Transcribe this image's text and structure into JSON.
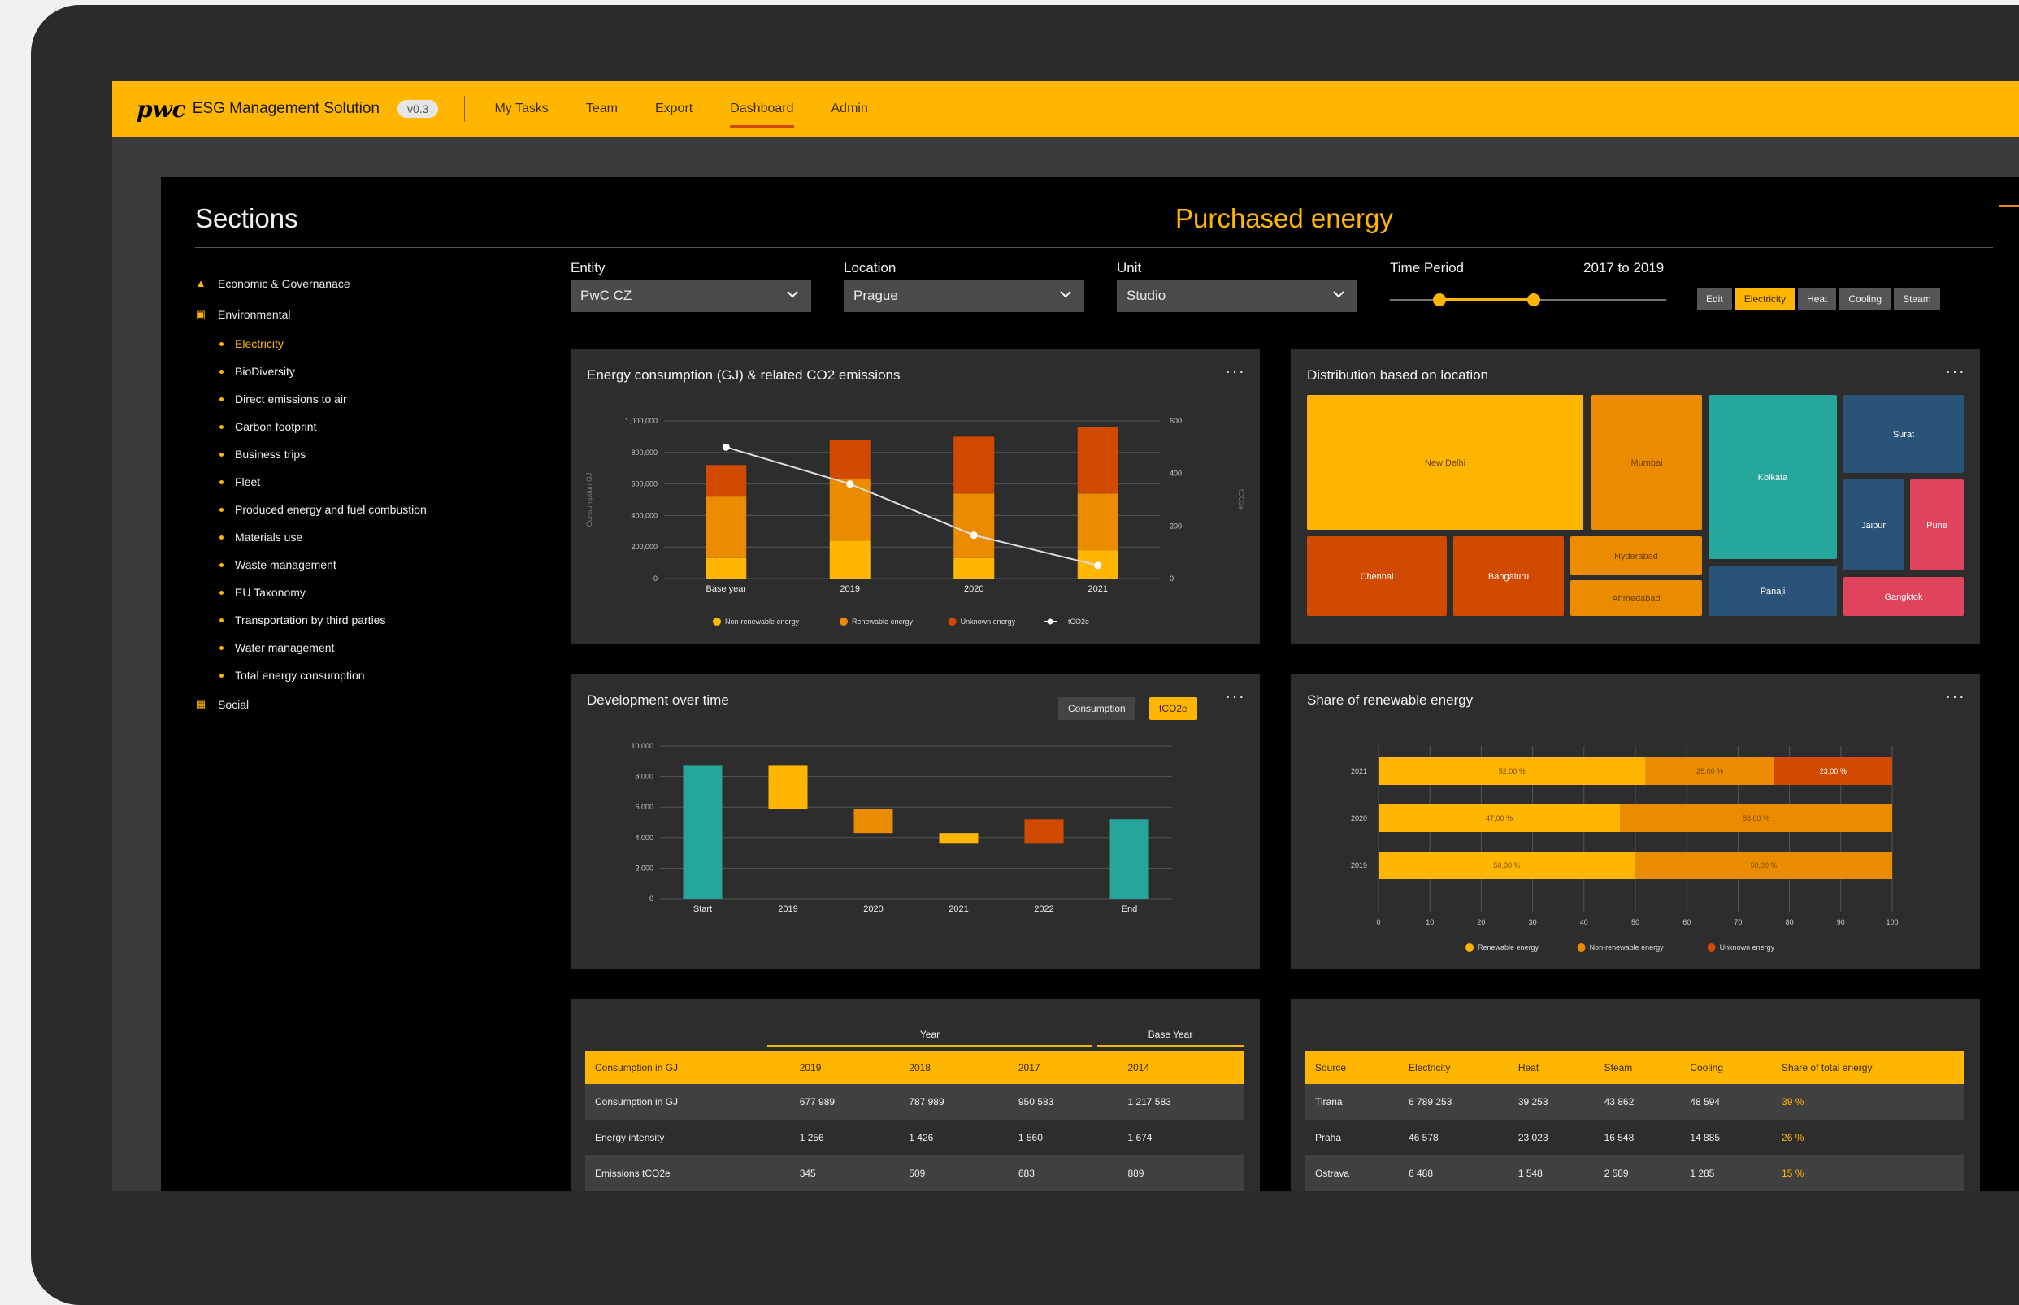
{
  "header": {
    "logo": "pwc",
    "app_name": "ESG Management Solution",
    "version": "v0.3",
    "nav": [
      "My Tasks",
      "Team",
      "Export",
      "Dashboard",
      "Admin"
    ],
    "active_nav": "Dashboard"
  },
  "sidebar": {
    "title": "Sections",
    "categories": [
      {
        "label": "Economic & Governanace",
        "icon": "building-icon"
      },
      {
        "label": "Environmental",
        "icon": "factory-icon",
        "items": [
          "Electricity",
          "BioDiversity",
          "Direct emissions to air",
          "Carbon footprint",
          "Business trips",
          "Fleet",
          "Produced energy and fuel combustion",
          "Materials use",
          "Waste management",
          "EU Taxonomy",
          "Transportation by third parties",
          "Water management",
          "Total energy consumption"
        ],
        "active_item": "Electricity"
      },
      {
        "label": "Social",
        "icon": "people-icon"
      }
    ]
  },
  "page": {
    "title": "Purchased energy"
  },
  "filters": {
    "entity": {
      "label": "Entity",
      "value": "PwC CZ"
    },
    "location": {
      "label": "Location",
      "value": "Prague"
    },
    "unit": {
      "label": "Unit",
      "value": "Studio"
    },
    "time_period": {
      "label": "Time Period",
      "value": "2017 to 2019",
      "range_start": 0.18,
      "range_end": 0.52
    },
    "types": [
      "Edit",
      "Electricity",
      "Heat",
      "Cooling",
      "Steam"
    ],
    "active_type": "Electricity"
  },
  "colors": {
    "yellow": "#ffb600",
    "orange": "#eb8c00",
    "dark_orange": "#d04a02",
    "teal": "#26a69a",
    "blue": "#295477",
    "pink": "#e0301e",
    "red": "#e0435c"
  },
  "charts": {
    "energy": {
      "title": "Energy consumption (GJ) & related CO2 emissions",
      "more": "···",
      "chart_data": {
        "type": "bar",
        "stacked": true,
        "categories": [
          "Base year",
          "2019",
          "2020",
          "2021"
        ],
        "series": [
          {
            "name": "Non-renewable energy",
            "values": [
              130000,
              240000,
              130000,
              180000
            ]
          },
          {
            "name": "Renewable energy",
            "values": [
              390000,
              390000,
              410000,
              360000
            ]
          },
          {
            "name": "Unknown energy",
            "values": [
              200000,
              250000,
              360000,
              420000
            ]
          }
        ],
        "line": {
          "name": "tCO2e",
          "values": [
            500,
            360,
            165,
            50
          ]
        },
        "ylabel": "Consumption GJ",
        "y2label": "tCO2e",
        "ylim": [
          0,
          1000000
        ],
        "y2lim": [
          0,
          600
        ],
        "yticks": [
          "0",
          "200,000",
          "400,000",
          "600,000",
          "800,000",
          "1,000,000"
        ],
        "y2ticks": [
          "0",
          "200",
          "400",
          "600"
        ]
      }
    },
    "distribution": {
      "title": "Distribution based on location",
      "more": "···",
      "chart_data": {
        "type": "treemap",
        "cells": [
          "New Delhi",
          "Mumbai",
          "Kolkata",
          "Surat",
          "Jaipur",
          "Pune",
          "Chennai",
          "Bangaluru",
          "Hyderabad",
          "Ahmedabad",
          "Panaji",
          "Gangktok"
        ]
      }
    },
    "development": {
      "title": "Development over time",
      "more": "···",
      "toggles": [
        "Consumption",
        "tCO2e"
      ],
      "active_toggle": "tCO2e",
      "chart_data": {
        "type": "waterfall",
        "categories": [
          "Start",
          "2019",
          "2020",
          "2021",
          "2022",
          "End"
        ],
        "bars": [
          [
            0,
            8700
          ],
          [
            5900,
            8700
          ],
          [
            4300,
            5900
          ],
          [
            3600,
            4300
          ],
          [
            3600,
            5200
          ],
          [
            0,
            5200
          ]
        ],
        "ylim": [
          0,
          10000
        ],
        "yticks": [
          "0",
          "2,000",
          "4,000",
          "6,000",
          "8,000",
          "10,000"
        ]
      }
    },
    "renewable": {
      "title": "Share of renewable energy",
      "more": "···",
      "chart_data": {
        "type": "bar",
        "orientation": "horizontal",
        "stacked": true,
        "categories": [
          "2021",
          "2020",
          "2019"
        ],
        "series": [
          {
            "name": "Renewable energy",
            "values": [
              52,
              47,
              50
            ]
          },
          {
            "name": "Non-renewable energy",
            "values": [
              25,
              53,
              50
            ]
          },
          {
            "name": "Unknown energy",
            "values": [
              23,
              0,
              0
            ]
          }
        ],
        "labels": [
          [
            "52,00 %",
            "25,00 %",
            "23,00 %"
          ],
          [
            "47,00 %",
            "53,00 %",
            ""
          ],
          [
            "50,00 %",
            "50,00 %",
            ""
          ]
        ],
        "xlim": [
          0,
          100
        ],
        "xticks": [
          "0",
          "10",
          "20",
          "30",
          "40",
          "50",
          "60",
          "70",
          "80",
          "90",
          "100"
        ]
      }
    }
  },
  "table1": {
    "group_year": "Year",
    "group_base": "Base Year",
    "headers": [
      "Consumption in GJ",
      "2019",
      "2018",
      "2017",
      "2014"
    ],
    "rows": [
      [
        "Consumption in GJ",
        "677 989",
        "787 989",
        "950 583",
        "1 217 583"
      ],
      [
        "Energy intensity",
        "1 256",
        "1 426",
        "1 560",
        "1 674"
      ],
      [
        "Emissions tCO2e",
        "345",
        "509",
        "683",
        "889"
      ]
    ]
  },
  "table2": {
    "headers": [
      "Source",
      "Electricity",
      "Heat",
      "Steam",
      "Cooling",
      "Share of total energy"
    ],
    "rows": [
      [
        "Tirana",
        "6 789 253",
        "39 253",
        "43 862",
        "48 594",
        "39 %"
      ],
      [
        "Praha",
        "46 578",
        "23 023",
        "16 548",
        "14 885",
        "26 %"
      ],
      [
        "Ostrava",
        "6 488",
        "1 548",
        "2 589",
        "1 285",
        "15 %"
      ]
    ]
  }
}
